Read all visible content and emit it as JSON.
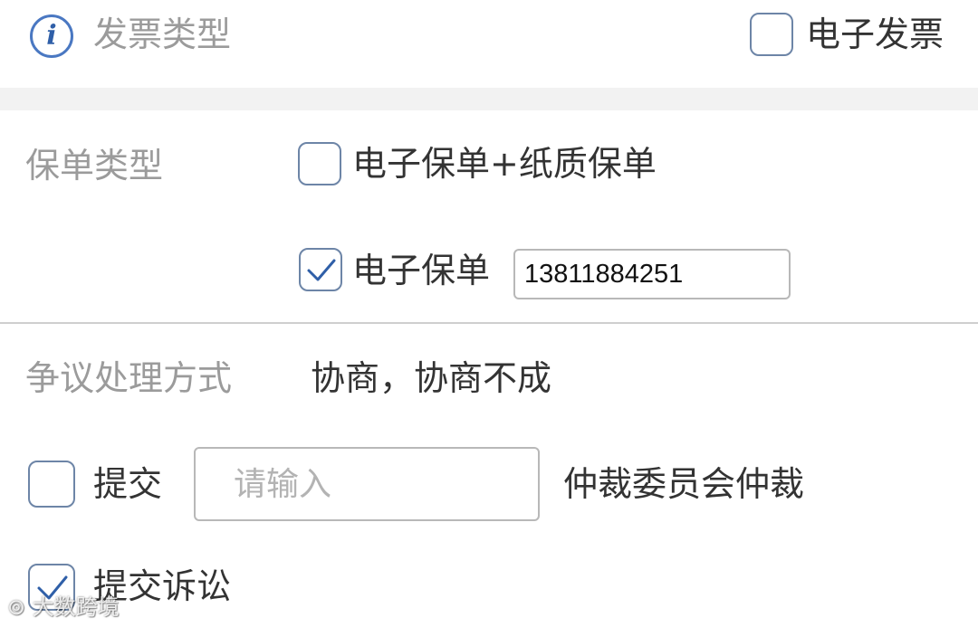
{
  "invoice": {
    "label": "发票类型",
    "option_electronic": "电子发票",
    "option_electronic_checked": false,
    "info_icon_glyph": "i"
  },
  "policy": {
    "label": "保单类型",
    "option_combined": "电子保单+纸质保单",
    "option_combined_checked": false,
    "option_electronic": "电子保单",
    "option_electronic_checked": true,
    "phone_value": "13811884251"
  },
  "dispute": {
    "label": "争议处理方式",
    "value": "协商，协商不成",
    "arbitration_prefix": "提交",
    "arbitration_checked": false,
    "arbitration_placeholder": "请输入",
    "arbitration_suffix": "仲裁委员会仲裁",
    "litigation_label": "提交诉讼",
    "litigation_checked": true
  },
  "watermark": {
    "text": "大数跨境"
  },
  "colors": {
    "accent": "#2f5fa8",
    "checkbox_border": "#6d85a7",
    "label_gray": "#9b9b9b",
    "text_dark": "#333333",
    "separator": "#f2f2f2"
  }
}
